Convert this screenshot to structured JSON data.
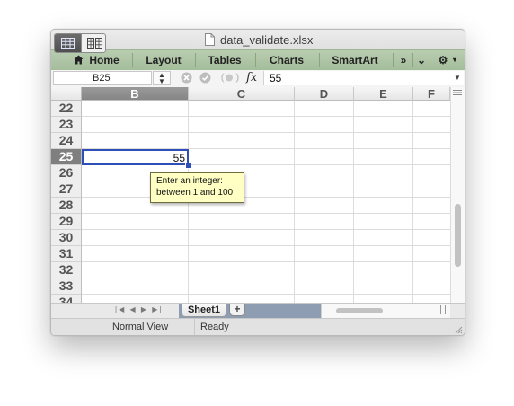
{
  "window": {
    "title": "data_validate.xlsx"
  },
  "ribbon": {
    "tabs": [
      "Home",
      "Layout",
      "Tables",
      "Charts",
      "SmartArt"
    ],
    "overflow": "»",
    "collapse": "⌄",
    "settings": "⚙"
  },
  "formula_bar": {
    "name_box": "B25",
    "fx_label": "fx",
    "value": "55"
  },
  "grid": {
    "columns": [
      "B",
      "C",
      "D",
      "E",
      "F"
    ],
    "selected_column": "B",
    "rows": [
      "22",
      "23",
      "24",
      "25",
      "26",
      "27",
      "28",
      "29",
      "30",
      "31",
      "32",
      "33",
      "34"
    ],
    "selected_row": "25",
    "active_cell": {
      "ref": "B25",
      "value": "55"
    },
    "input_message": {
      "title": "Enter an integer:",
      "body": "between 1 and 100"
    }
  },
  "sheet_tabs": {
    "tabs": [
      "Sheet1"
    ],
    "add": "+"
  },
  "status_bar": {
    "view": "Normal View",
    "state": "Ready"
  },
  "colors": {
    "ribbon": "#a9c1a0",
    "selection_border": "#2e4fb5",
    "tooltip_bg": "#ffffc4",
    "close": "#fc5f57",
    "minimize": "#fdbc2e",
    "zoom": "#28c840"
  }
}
